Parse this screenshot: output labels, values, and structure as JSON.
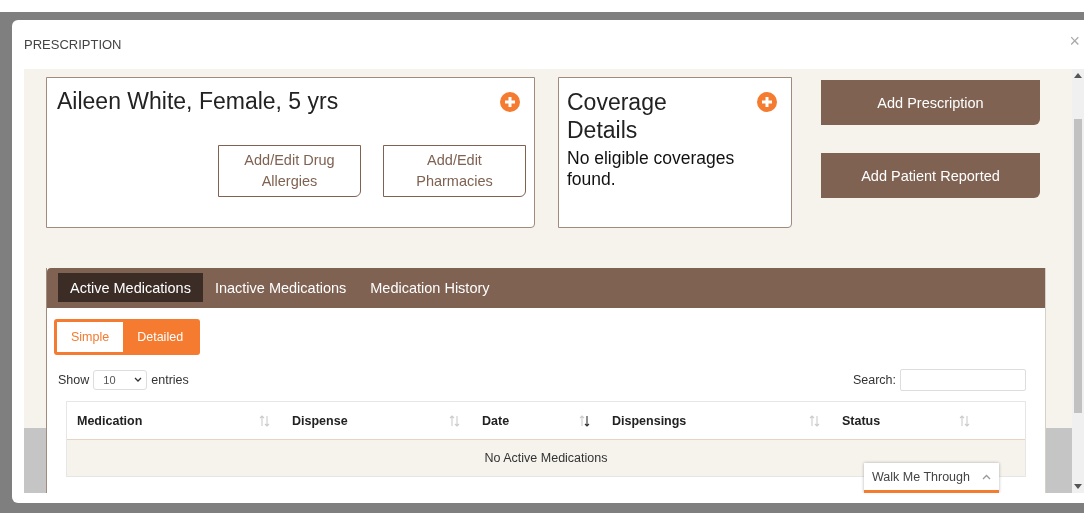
{
  "window": {
    "title": "PRESCRIPTION",
    "close": "×"
  },
  "patient": {
    "name": "Aileen White, Female, 5 yrs",
    "buttons": [
      "Add/Edit Drug Allergies",
      "Add/Edit Pharmacies"
    ]
  },
  "coverage": {
    "title": "Coverage Details",
    "message": "No eligible coverages found."
  },
  "actions": [
    "Add Prescription",
    "Add Patient Reported"
  ],
  "tabs": [
    {
      "label": "Active Medications",
      "selected": true
    },
    {
      "label": "Inactive Medications",
      "selected": false
    },
    {
      "label": "Medication History",
      "selected": false
    }
  ],
  "view_toggle": [
    {
      "label": "Simple",
      "selected": false
    },
    {
      "label": "Detailed",
      "selected": true
    }
  ],
  "length": {
    "before": "Show",
    "value": "10",
    "after": "entries"
  },
  "search": {
    "label": "Search:"
  },
  "table": {
    "columns": [
      {
        "label": "Medication",
        "sorted": false
      },
      {
        "label": "Dispense",
        "sorted": false
      },
      {
        "label": "Date",
        "sorted": true
      },
      {
        "label": "Dispensings",
        "sorted": false
      },
      {
        "label": "Status",
        "sorted": false
      }
    ],
    "empty": "No Active Medications"
  },
  "walk_me": {
    "label": "Walk Me Through"
  }
}
